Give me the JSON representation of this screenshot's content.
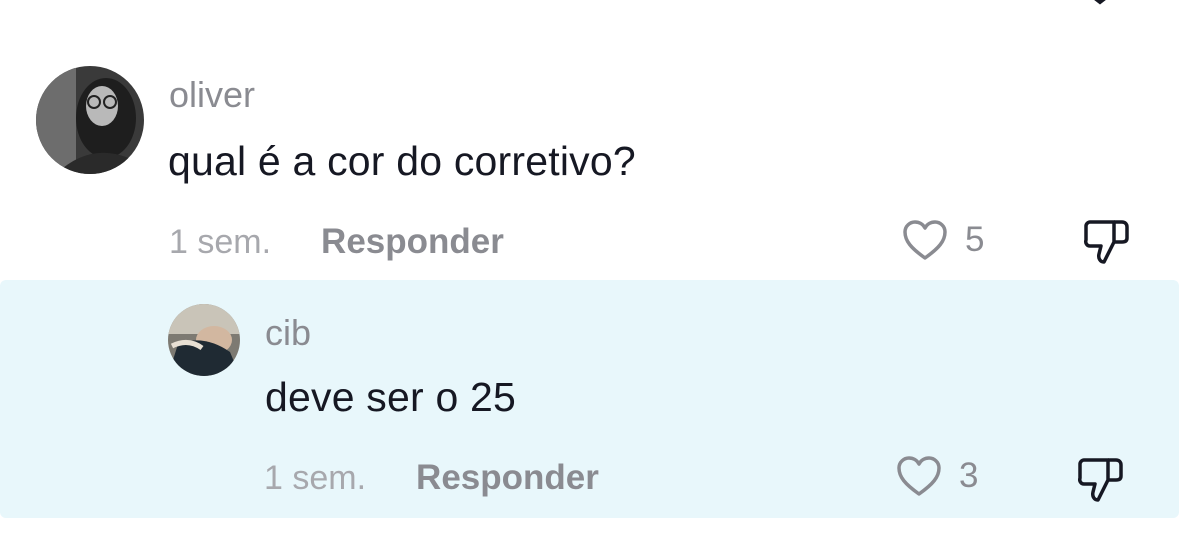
{
  "comments": [
    {
      "username": "oliver",
      "text": "qual é a cor do corretivo?",
      "timestamp": "1 sem.",
      "reply_label": "Responder",
      "likes": "5",
      "like_icon": "heart-outline-icon",
      "dislike_icon": "thumbs-down-icon"
    },
    {
      "username": "cib",
      "text": "deve ser o 25",
      "timestamp": "1 sem.",
      "reply_label": "Responder",
      "likes": "3",
      "like_icon": "heart-outline-icon",
      "dislike_icon": "thumbs-down-icon"
    }
  ],
  "colors": {
    "reply_background": "#e8f7fb",
    "muted_text": "#8a8b91",
    "primary_text": "#161823"
  }
}
